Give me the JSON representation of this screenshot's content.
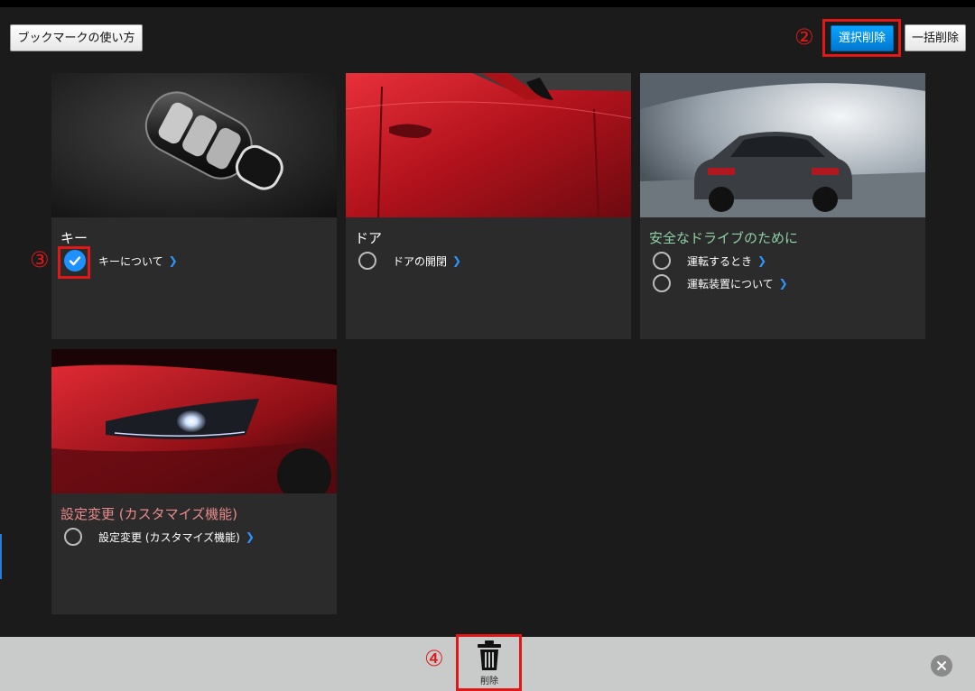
{
  "header": {
    "bookmark_help_label": "ブックマークの使い方",
    "select_delete_label": "選択削除",
    "delete_all_label": "一括削除"
  },
  "annotations": {
    "two": "②",
    "three": "③",
    "four": "④"
  },
  "cards": [
    {
      "title": "キー",
      "title_color": "#ffffff",
      "items": [
        {
          "label": "キーについて",
          "checked": true
        }
      ]
    },
    {
      "title": "ドア",
      "title_color": "#ffffff",
      "items": [
        {
          "label": "ドアの開閉",
          "checked": false
        }
      ]
    },
    {
      "title": "安全なドライブのために",
      "title_color": "#8fd0a5",
      "items": [
        {
          "label": "運転するとき",
          "checked": false
        },
        {
          "label": "運転装置について",
          "checked": false
        }
      ]
    },
    {
      "title": "設定変更 (カスタマイズ機能)",
      "title_color": "#e88a8a",
      "items": [
        {
          "label": "設定変更 (カスタマイズ機能)",
          "checked": false
        }
      ]
    }
  ],
  "bottom_bar": {
    "delete_label": "削除"
  },
  "colors": {
    "accent_blue": "#0a8fe8",
    "annotation_red": "#e01818",
    "background": "#1b1b1b",
    "card_bg": "#2b2b2b",
    "bottom_bar_bg": "#c9cbca"
  }
}
